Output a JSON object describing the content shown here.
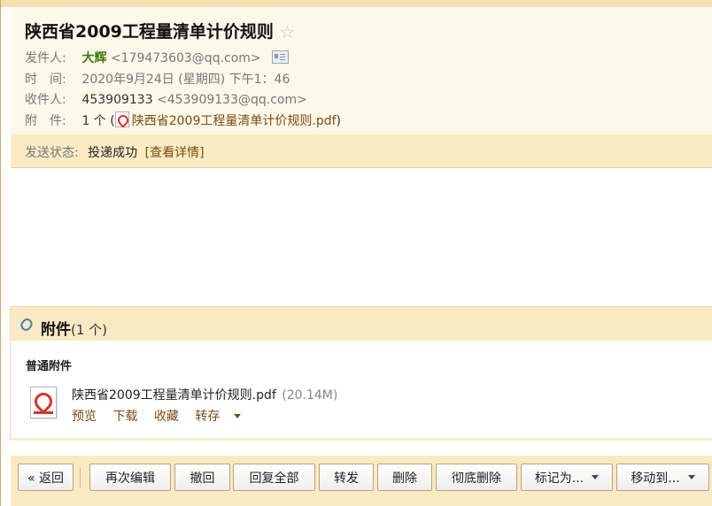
{
  "email": {
    "subject": "陕西省2009工程量清单计价规则",
    "star_icon": "star-outline-icon",
    "sender_label": "发件人:",
    "sender_name": "大辉",
    "sender_email": "<179473603@qq.com>",
    "time_label": "时　间:",
    "time_value": "2020年9月24日 (星期四) 下午1：46",
    "recipient_label": "收件人:",
    "recipient_name": "453909133",
    "recipient_email": "<453909133@qq.com>",
    "attachment_label": "附　件:",
    "attachment_count_prefix": "1 个 (",
    "attachment_link": "陕西省2009工程量清单计价规则.pdf",
    "attachment_count_suffix": ")"
  },
  "status": {
    "label": "发送状态:",
    "value": "投递成功",
    "details_link": "[查看详情]"
  },
  "attachments": {
    "title": "附件",
    "count": "(1 个)",
    "section_label": "普通附件",
    "files": [
      {
        "name": "陕西省2009工程量清单计价规则.pdf",
        "size": "(20.14M)",
        "actions": {
          "preview": "预览",
          "download": "下载",
          "collect": "收藏",
          "save_to": "转存"
        }
      }
    ]
  },
  "toolbar": {
    "back": "« 返回",
    "edit_again": "再次编辑",
    "withdraw": "撤回",
    "reply_all": "回复全部",
    "forward": "转发",
    "delete": "删除",
    "delete_permanently": "彻底删除",
    "mark_as": "标记为...",
    "move_to": "移动到..."
  },
  "colors": {
    "header_bg": "#fdf8e9",
    "status_bg": "#faebc4",
    "link_brown": "#7a4b12",
    "sender_green": "#3d7a0c"
  }
}
